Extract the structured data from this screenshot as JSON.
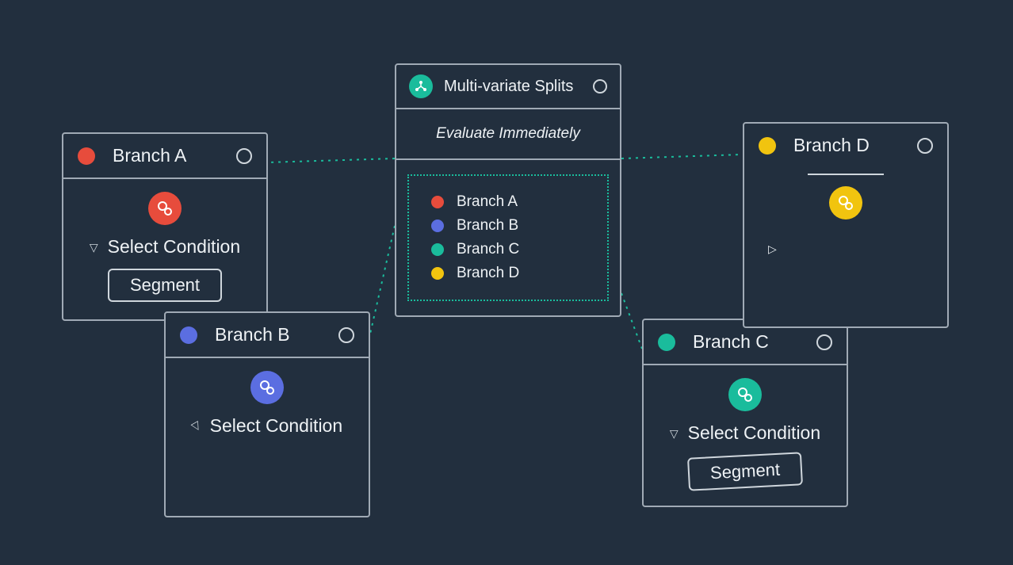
{
  "center": {
    "title": "Multi-variate Splits",
    "subtitle": "Evaluate Immediately",
    "branches": [
      {
        "label": "Branch A",
        "color": "#e74c3c"
      },
      {
        "label": "Branch B",
        "color": "#5b6ee1"
      },
      {
        "label": "Branch C",
        "color": "#1abc9c"
      },
      {
        "label": "Branch D",
        "color": "#f1c40f"
      }
    ]
  },
  "cardA": {
    "title": "Branch A",
    "select": "Select Condition",
    "pill": "Segment"
  },
  "cardB": {
    "title": "Branch B",
    "select": "Select Condition"
  },
  "cardC": {
    "title": "Branch C",
    "select": "Select Condition",
    "pill": "Segment"
  },
  "cardD": {
    "title": "Branch D"
  }
}
